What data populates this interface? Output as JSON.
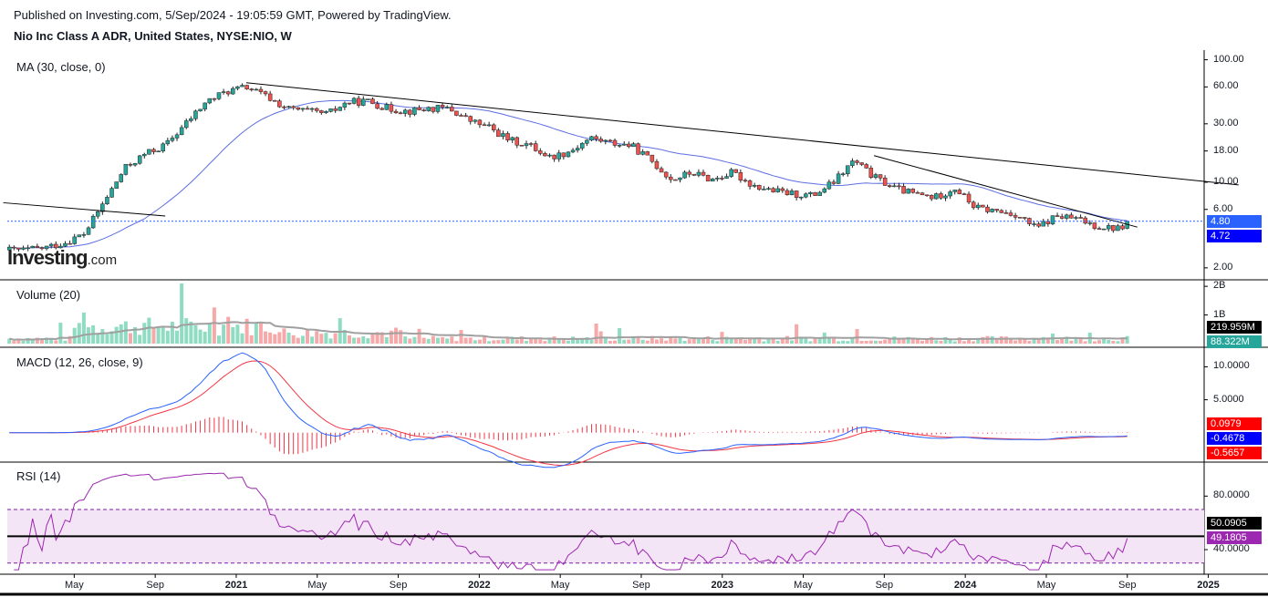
{
  "header": {
    "publish_line": "Published on Investing.com, 5/Sep/2024 - 19:05:59 GMT, Powered by TradingView.",
    "symbol_line": "Nio Inc Class A ADR, United States, NYSE:NIO, W"
  },
  "logo": {
    "brand": "Investing",
    "suffix": ".com"
  },
  "colors": {
    "up": "#26a69a",
    "down": "#ef5350",
    "ma": "#5b6ee1",
    "macd": "#2962ff",
    "signal": "#f23645",
    "rsi": "#9c27b0",
    "rsi_band": "#f3e5f5",
    "volume_ma": "#a0a0a0",
    "price_badge_top": "#2962ff",
    "price_badge_bottom": "#0000ff",
    "vol_badge_top": "#000000",
    "vol_badge_bottom": "#26a69a",
    "macd_badge_hist": "#ff0000",
    "macd_badge_macd": "#0000ff",
    "macd_badge_signal": "#ff0000",
    "rsi_badge_line": "#000000",
    "rsi_badge_rsi": "#9c27b0"
  },
  "chart_data": [
    {
      "type": "candlestick",
      "panel": "price",
      "title": "MA (30, close, 0)",
      "y_scale": "log",
      "ylim": [
        1.8,
        110
      ],
      "y_ticks": [
        "100.00",
        "60.00",
        "30.00",
        "18.00",
        "10.00",
        "6.00",
        "2.00"
      ],
      "y_tick_values": [
        100,
        60,
        30,
        18,
        10,
        6,
        2
      ],
      "x_ticks": [
        "May",
        "Sep",
        "2021",
        "May",
        "Sep",
        "2022",
        "May",
        "Sep",
        "2023",
        "May",
        "Sep",
        "2024",
        "May",
        "Sep",
        "2025"
      ],
      "x_tick_dates": [
        "2020-05",
        "2020-09",
        "2021-01",
        "2021-05",
        "2021-09",
        "2022-01",
        "2022-05",
        "2022-09",
        "2023-01",
        "2023-05",
        "2023-09",
        "2024-01",
        "2024-05",
        "2024-09",
        "2025-01"
      ],
      "close_series": {
        "dates": [
          "2020-02",
          "2020-03",
          "2020-04",
          "2020-05",
          "2020-06",
          "2020-07",
          "2020-08",
          "2020-09",
          "2020-10",
          "2020-11",
          "2020-12",
          "2021-01",
          "2021-02",
          "2021-03",
          "2021-04",
          "2021-05",
          "2021-06",
          "2021-07",
          "2021-08",
          "2021-09",
          "2021-10",
          "2021-11",
          "2021-12",
          "2022-01",
          "2022-02",
          "2022-03",
          "2022-04",
          "2022-05",
          "2022-06",
          "2022-07",
          "2022-08",
          "2022-09",
          "2022-10",
          "2022-11",
          "2022-12",
          "2023-01",
          "2023-02",
          "2023-03",
          "2023-04",
          "2023-05",
          "2023-06",
          "2023-07",
          "2023-08",
          "2023-09",
          "2023-10",
          "2023-11",
          "2023-12",
          "2024-01",
          "2024-02",
          "2024-03",
          "2024-04",
          "2024-05",
          "2024-06",
          "2024-07",
          "2024-08",
          "2024-09"
        ],
        "values": [
          2.8,
          2.9,
          3.2,
          3.8,
          7.0,
          13.0,
          17.0,
          20.0,
          30.0,
          45.0,
          55.0,
          60.0,
          50.0,
          40.0,
          38.0,
          36.0,
          45.0,
          46.0,
          40.0,
          38.0,
          40.0,
          40.0,
          32.0,
          28.0,
          22.0,
          20.0,
          16.0,
          18.0,
          23.0,
          21.0,
          20.0,
          15.0,
          10.5,
          12.0,
          10.5,
          12.0,
          9.5,
          8.5,
          8.0,
          7.8,
          10.0,
          15.0,
          11.0,
          9.0,
          8.0,
          7.5,
          9.0,
          6.2,
          5.8,
          5.5,
          4.2,
          5.3,
          5.0,
          4.4,
          4.2,
          4.8
        ]
      },
      "series": [
        {
          "name": "MA",
          "type": "line"
        }
      ],
      "last_price": 4.8,
      "ma_value": 4.72,
      "badges": [
        "4.80",
        "4.72"
      ],
      "trendlines": [
        {
          "from": [
            "2021-01",
            65
          ],
          "to": [
            "2025-02",
            9.5
          ]
        },
        {
          "from": [
            "2023-08",
            16.5
          ],
          "to": [
            "2024-09",
            4.3
          ]
        },
        {
          "from": [
            "2020-01",
            6.8
          ],
          "to": [
            "2020-09",
            5.3
          ]
        }
      ]
    },
    {
      "type": "bar",
      "panel": "volume",
      "title": "Volume (20)",
      "y_ticks": [
        "2B",
        "1B"
      ],
      "y_tick_values": [
        2000000000,
        1000000000
      ],
      "series": [
        {
          "name": "Volume"
        },
        {
          "name": "Volume MA"
        }
      ],
      "badges": [
        "219.959M",
        "88.322M"
      ]
    },
    {
      "type": "line",
      "panel": "macd",
      "title": "MACD (12, 26, close, 9)",
      "ylim": [
        -3.5,
        12
      ],
      "y_ticks": [
        "10.0000",
        "5.0000"
      ],
      "y_tick_values": [
        10,
        5
      ],
      "series": [
        {
          "name": "MACD"
        },
        {
          "name": "Signal"
        },
        {
          "name": "Histogram",
          "type": "bar"
        }
      ],
      "badges": [
        "0.0979",
        "-0.4678",
        "-0.5657"
      ]
    },
    {
      "type": "line",
      "panel": "rsi",
      "title": "RSI (14)",
      "ylim": [
        23,
        102
      ],
      "y_ticks": [
        "80.0000",
        "40.0000"
      ],
      "y_tick_values": [
        80,
        40
      ],
      "band": [
        30,
        70
      ],
      "midline": 50,
      "series": [
        {
          "name": "RSI"
        }
      ],
      "badges": [
        "50.0905",
        "49.1805"
      ]
    }
  ]
}
